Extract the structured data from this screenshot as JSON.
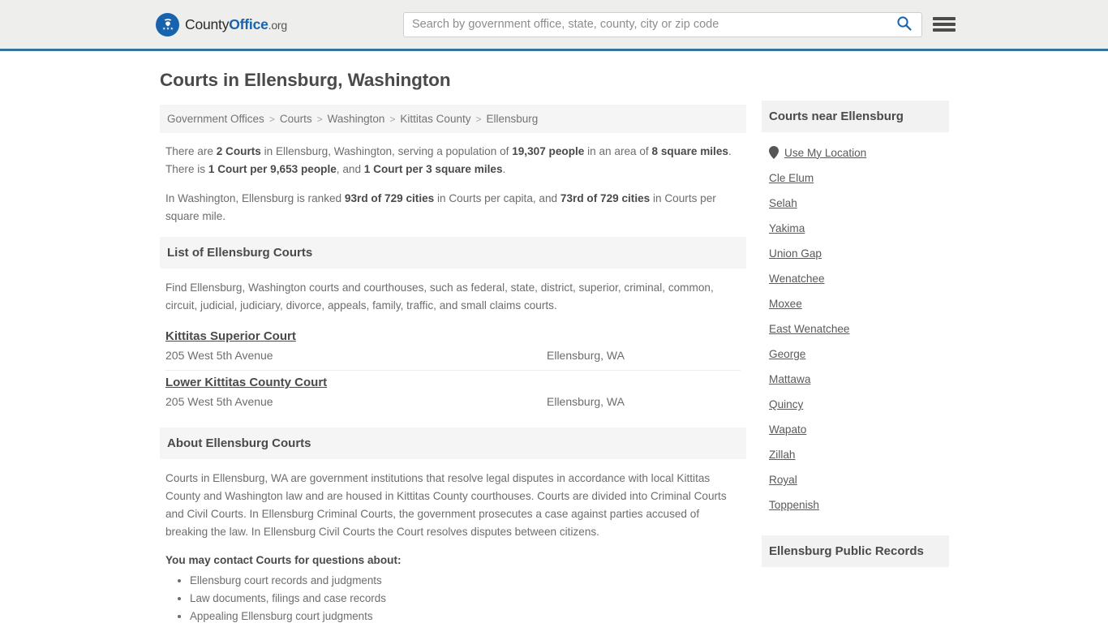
{
  "header": {
    "brand": {
      "county": "County",
      "office": "Office",
      "org": ".org",
      "icon": "eagle-shield-icon"
    },
    "search": {
      "placeholder": "Search by government office, state, county, city or zip code",
      "value": "",
      "icon": "search-icon"
    },
    "menu_icon": "hamburger-menu-icon",
    "accent_color": "#35729e",
    "background_color": "#eeeeec"
  },
  "page": {
    "title": "Courts in Ellensburg, Washington"
  },
  "breadcrumb": {
    "separator": ">",
    "items": [
      {
        "label": "Government Offices"
      },
      {
        "label": "Courts"
      },
      {
        "label": "Washington"
      },
      {
        "label": "Kittitas County"
      },
      {
        "label": "Ellensburg"
      }
    ]
  },
  "intro": {
    "p1": [
      {
        "t": "There are ",
        "b": false
      },
      {
        "t": "2 Courts",
        "b": true
      },
      {
        "t": " in Ellensburg, Washington, serving a population of ",
        "b": false
      },
      {
        "t": "19,307 people",
        "b": true
      },
      {
        "t": " in an area of ",
        "b": false
      },
      {
        "t": "8 square miles",
        "b": true
      },
      {
        "t": ". There is ",
        "b": false
      },
      {
        "t": "1 Court per 9,653 people",
        "b": true
      },
      {
        "t": ", and ",
        "b": false
      },
      {
        "t": "1 Court per 3 square miles",
        "b": true
      },
      {
        "t": ".",
        "b": false
      }
    ],
    "p2": [
      {
        "t": "In Washington, Ellensburg is ranked ",
        "b": false
      },
      {
        "t": "93rd of 729 cities",
        "b": true
      },
      {
        "t": " in Courts per capita, and ",
        "b": false
      },
      {
        "t": "73rd of 729 cities",
        "b": true
      },
      {
        "t": " in Courts per square mile.",
        "b": false
      }
    ]
  },
  "list_section": {
    "heading": "List of Ellensburg Courts",
    "description": "Find Ellensburg, Washington courts and courthouses, such as federal, state, district, superior, criminal, common, circuit, judicial, judiciary, divorce, appeals, family, traffic, and small claims courts.",
    "courts": [
      {
        "name": "Kittitas Superior Court",
        "address": "205 West 5th Avenue",
        "city": "Ellensburg, WA"
      },
      {
        "name": "Lower Kittitas County Court",
        "address": "205 West 5th Avenue",
        "city": "Ellensburg, WA"
      }
    ]
  },
  "about_section": {
    "heading": "About Ellensburg Courts",
    "body": "Courts in Ellensburg, WA are government institutions that resolve legal disputes in accordance with local Kittitas County and Washington law and are housed in Kittitas County courthouses. Courts are divided into Criminal Courts and Civil Courts. In Ellensburg Criminal Courts, the government prosecutes a case against parties accused of breaking the law. In Ellensburg Civil Courts the Court resolves disputes between citizens.",
    "contact_lead": "You may contact Courts for questions about:",
    "contact_items": [
      "Ellensburg court records and judgments",
      "Law documents, filings and case records",
      "Appealing Ellensburg court judgments"
    ]
  },
  "sidebar": {
    "nearby_heading": "Courts near Ellensburg",
    "use_my_location": "Use My Location",
    "pin_icon": "map-pin-icon",
    "cities": [
      "Cle Elum",
      "Selah",
      "Yakima",
      "Union Gap",
      "Wenatchee",
      "Moxee",
      "East Wenatchee",
      "George",
      "Mattawa",
      "Quincy",
      "Wapato",
      "Zillah",
      "Royal",
      "Toppenish"
    ],
    "records_heading": "Ellensburg Public Records"
  }
}
